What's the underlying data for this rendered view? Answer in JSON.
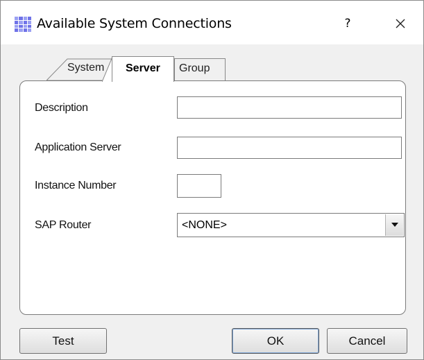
{
  "window": {
    "title": "Available System Connections",
    "help_label": "?"
  },
  "tabs": [
    {
      "label": "System",
      "selected": false
    },
    {
      "label": "Server",
      "selected": true
    },
    {
      "label": "Group",
      "selected": false
    }
  ],
  "form": {
    "description_label": "Description",
    "description_value": "",
    "app_server_label": "Application Server",
    "app_server_value": "",
    "instance_label": "Instance Number",
    "instance_value": "",
    "router_label": "SAP Router",
    "router_value": "<NONE>"
  },
  "buttons": {
    "test": "Test",
    "ok": "OK",
    "cancel": "Cancel"
  },
  "colors": {
    "accent_icon": "#6f72e8",
    "dialog_bg": "#f0f0f0"
  }
}
